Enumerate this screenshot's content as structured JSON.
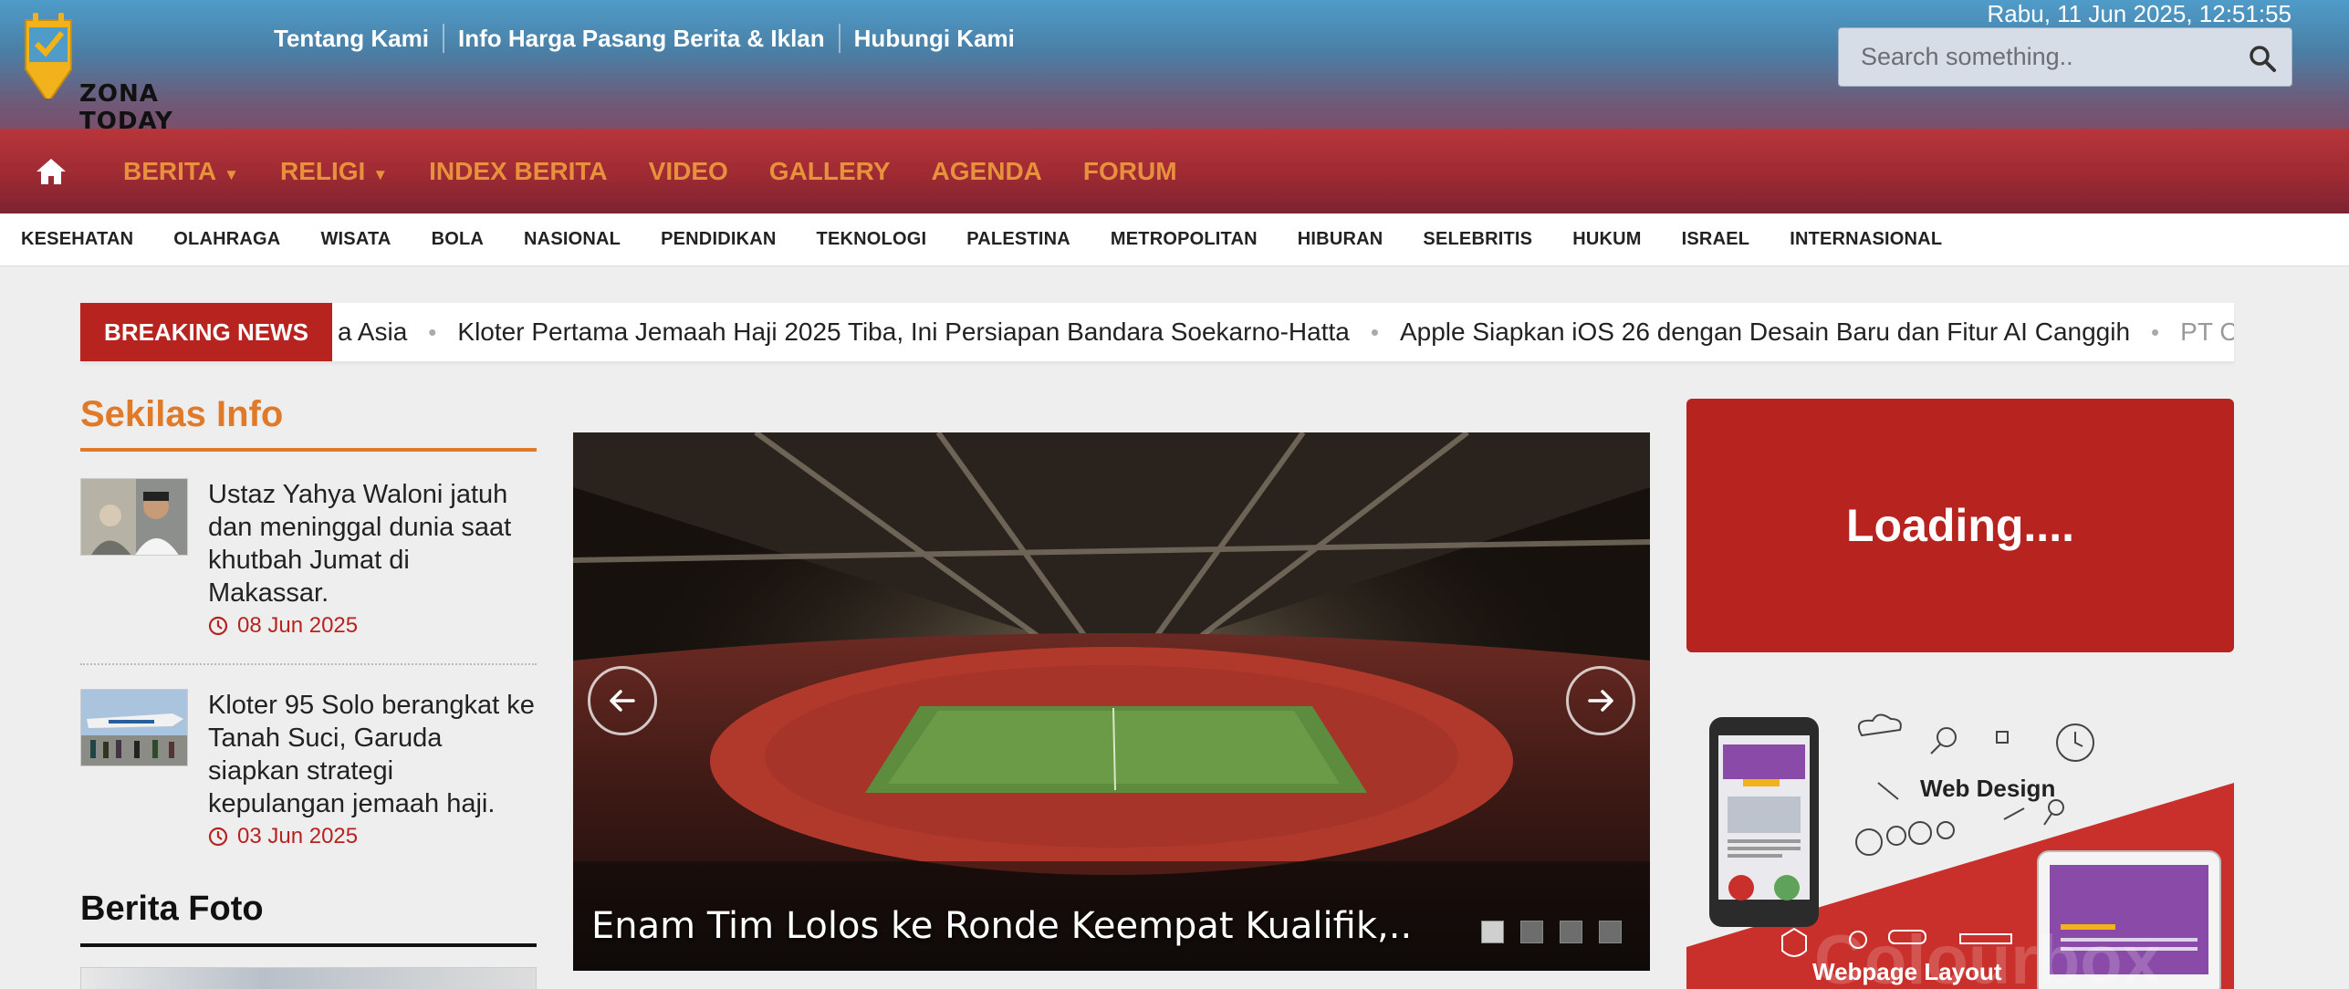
{
  "header": {
    "logo_text": "ZONA TODAY",
    "links": [
      "Tentang Kami",
      "Info Harga Pasang Berita & Iklan",
      "Hubungi Kami"
    ],
    "datetime": "Rabu, 11 Jun 2025, 12:51:55",
    "search_placeholder": "Search something..",
    "search_icon": "search-icon"
  },
  "nav": {
    "home_icon": "home-icon",
    "items": [
      {
        "label": "BERITA",
        "dropdown": true
      },
      {
        "label": "RELIGI",
        "dropdown": true
      },
      {
        "label": "INDEX BERITA",
        "dropdown": false
      },
      {
        "label": "VIDEO",
        "dropdown": false
      },
      {
        "label": "GALLERY",
        "dropdown": false
      },
      {
        "label": "AGENDA",
        "dropdown": false
      },
      {
        "label": "FORUM",
        "dropdown": false
      }
    ],
    "caret": "▼"
  },
  "categories": [
    "KESEHATAN",
    "OLAHRAGA",
    "WISATA",
    "BOLA",
    "NASIONAL",
    "PENDIDIKAN",
    "TEKNOLOGI",
    "PALESTINA",
    "METROPOLITAN",
    "HIBURAN",
    "SELEBRITIS",
    "HUKUM",
    "ISRAEL",
    "INTERNASIONAL"
  ],
  "breaking": {
    "label": "BREAKING NEWS",
    "items": [
      "a Asia",
      "Kloter Pertama Jemaah Haji 2025 Tiba, Ini Persiapan Bandara Soekarno-Hatta",
      "Apple Siapkan iOS 26 dengan Desain Baru dan Fitur AI Canggih",
      "PT C"
    ],
    "separator": "•"
  },
  "sekilas": {
    "title": "Sekilas Info",
    "items": [
      {
        "text": "Ustaz Yahya Waloni jatuh dan meninggal dunia saat khutbah Jumat di Makassar.",
        "date": "08 Jun 2025"
      },
      {
        "text": "Kloter 95 Solo berangkat ke Tanah Suci, Garuda siapkan strategi kepulangan jemaah haji.",
        "date": "03 Jun 2025"
      }
    ]
  },
  "berita_foto": {
    "title": "Berita Foto"
  },
  "slider": {
    "caption": "Enam Tim Lolos ke Ronde Keempat Kualifik,..",
    "active_dot": 0,
    "dot_count": 4
  },
  "widgets": {
    "loading": "Loading....",
    "ad_title": "Web Design",
    "ad_subtitle": "Webpage Layout",
    "ad_watermark": "Colourbox"
  },
  "colors": {
    "brand_red": "#b7231f",
    "nav_orange": "#e8913c",
    "section_orange": "#e07a2b",
    "header_blue": "#4f9cc9"
  }
}
